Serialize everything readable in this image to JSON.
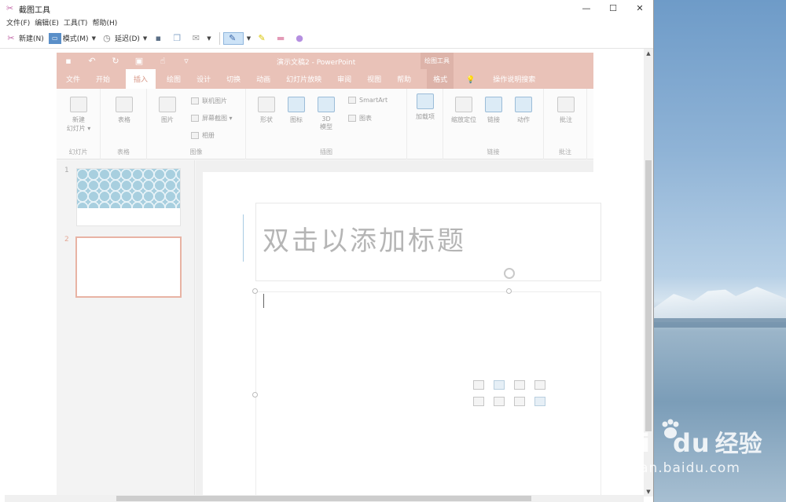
{
  "window": {
    "title": "截图工具",
    "controls": [
      "—",
      "☐",
      "✕"
    ]
  },
  "menu": [
    "文件(F)",
    "编辑(E)",
    "工具(T)",
    "帮助(H)"
  ],
  "toolbar": {
    "new_label": "新建(N)",
    "mode_label": "模式(M)",
    "delay_label": "延迟(D)"
  },
  "ppt": {
    "doc_title": "演示文稿2  -  PowerPoint",
    "context_tab": "绘图工具",
    "tabs": [
      "文件",
      "开始",
      "插入",
      "绘图",
      "设计",
      "切换",
      "动画",
      "幻灯片放映",
      "审阅",
      "视图",
      "帮助",
      "格式",
      "操作说明搜索"
    ],
    "active_tab": "插入",
    "ribbon": {
      "new_slide": "新建\n幻灯片 ▾",
      "group_slides": "幻灯片",
      "table": "表格",
      "group_tables": "表格",
      "picture": "图片",
      "online_pictures": "联机图片",
      "screenshot": "屏幕截图 ▾",
      "album": "相册",
      "group_images": "图像",
      "shapes": "形状",
      "icons": "图标",
      "models3d": "3D\n模型",
      "smartart": "SmartArt",
      "chart": "图表",
      "group_illustrations": "插图",
      "addins": "加载项",
      "zoom": "缩放定位",
      "link": "链接",
      "action": "动作",
      "group_links": "链接",
      "comment": "批注",
      "group_comments": "批注"
    },
    "slide_numbers": [
      "1",
      "2"
    ],
    "title_placeholder": "双击以添加标题"
  },
  "watermark": {
    "logo": "Bai",
    "logo2": "du",
    "cn": "经验",
    "url": "jingyan.baidu.com"
  }
}
